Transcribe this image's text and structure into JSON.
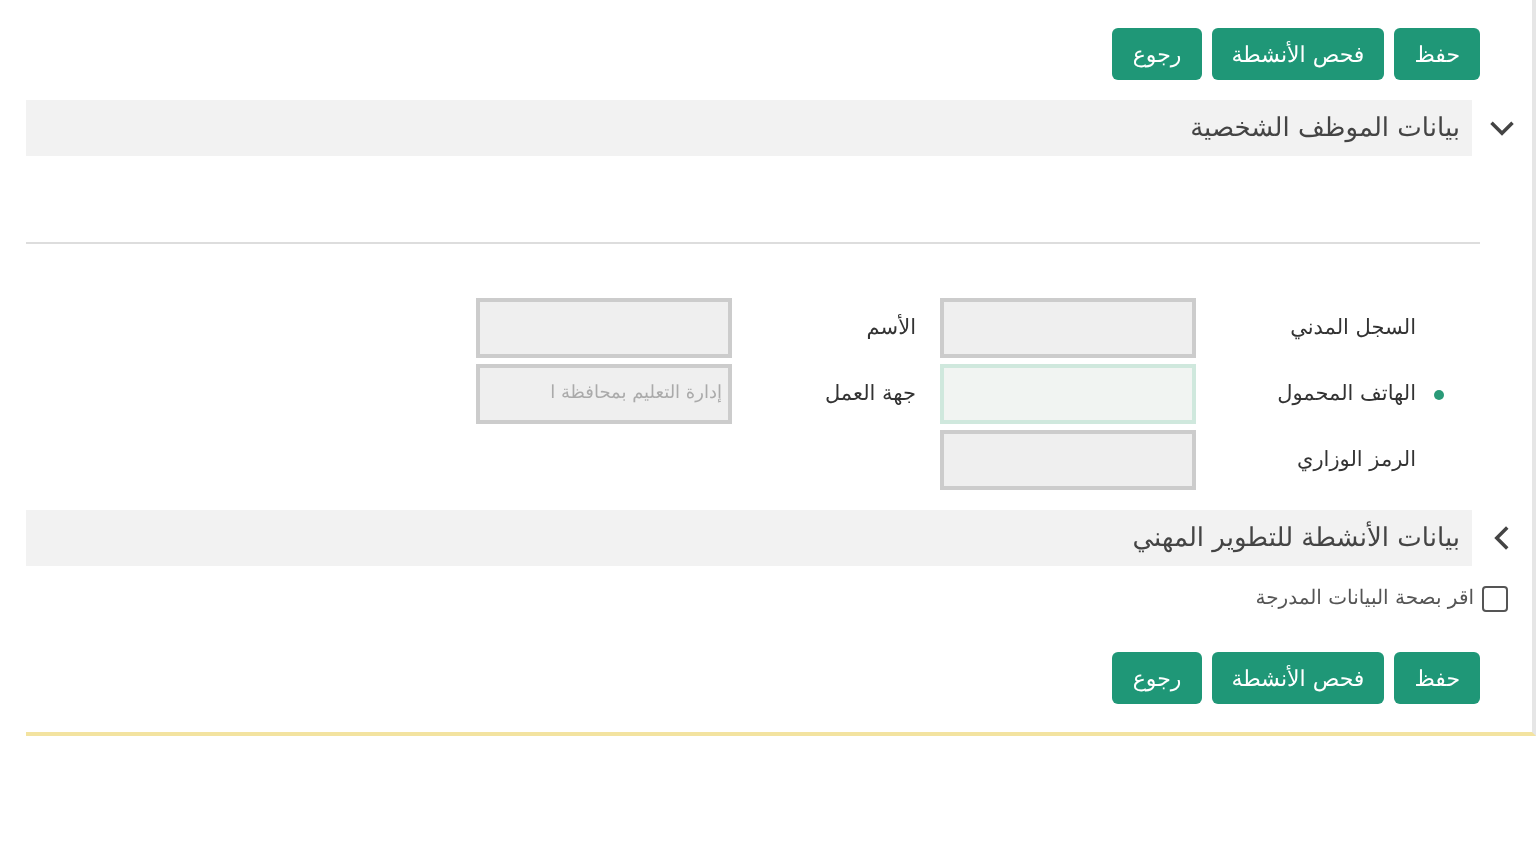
{
  "top_buttons": [
    "حفظ",
    "فحص الأنشطة",
    "رجوع"
  ],
  "sections": [
    {
      "title": "بيانات الموظف الشخصية",
      "expanded": true
    },
    {
      "title": "بيانات الأنشطة للتطوير المهني",
      "expanded": false
    }
  ],
  "fields": [
    {
      "label": "السجل المدني",
      "required": false,
      "focused": false
    },
    {
      "label": "الأسم",
      "required": false,
      "focused": false
    },
    {
      "label": "الهاتف المحمول",
      "required": true,
      "focused": true
    },
    {
      "label": "جهة العمل",
      "required": false,
      "focused": false,
      "value": "إدارة التعليم بمحافظة ا"
    },
    {
      "label": "الرمز الوزاري",
      "required": false,
      "focused": false
    }
  ],
  "confirm": {
    "label": "اقر بصحة البيانات المدرجة",
    "checked": false
  },
  "bottom_buttons": [
    "حفظ",
    "فحص الأنشطة",
    "رجوع"
  ]
}
